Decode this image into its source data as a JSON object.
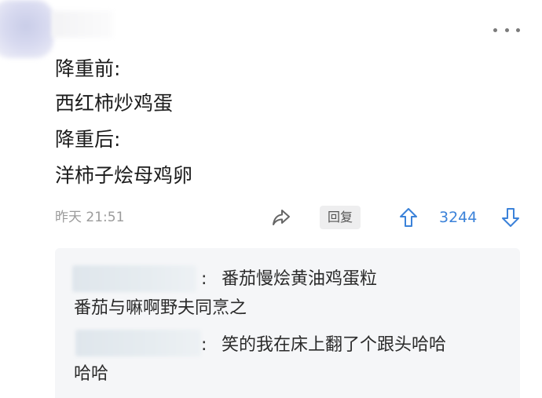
{
  "post": {
    "more_icon": "more-horizontal-icon",
    "lines": [
      "降重前:",
      "西红柿炒鸡蛋",
      "降重后:",
      "洋柿子烩母鸡卵"
    ],
    "timestamp": "昨天 21:51",
    "reply_label": "回复",
    "vote_count": "3244",
    "accent_color": "#3b82d9"
  },
  "replies": [
    {
      "colon": ":",
      "text_line1": "番茄慢烩黄油鸡蛋粒",
      "text_line2": "番茄与嘛啊野夫同烹之"
    },
    {
      "colon": ":",
      "text_line1": "笑的我在床上翻了个跟头哈哈",
      "text_line2": "哈哈"
    }
  ]
}
